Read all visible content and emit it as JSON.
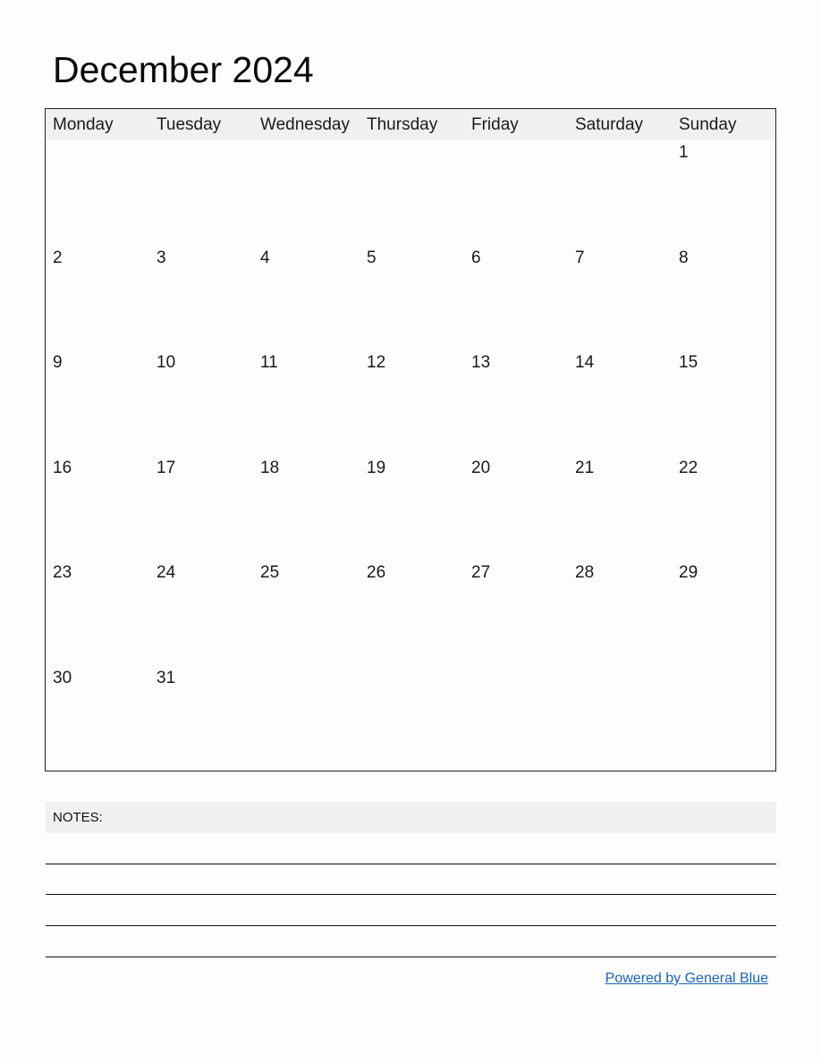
{
  "title": "December 2024",
  "weekdays": [
    "Monday",
    "Tuesday",
    "Wednesday",
    "Thursday",
    "Friday",
    "Saturday",
    "Sunday"
  ],
  "weeks": [
    [
      "",
      "",
      "",
      "",
      "",
      "",
      "1"
    ],
    [
      "2",
      "3",
      "4",
      "5",
      "6",
      "7",
      "8"
    ],
    [
      "9",
      "10",
      "11",
      "12",
      "13",
      "14",
      "15"
    ],
    [
      "16",
      "17",
      "18",
      "19",
      "20",
      "21",
      "22"
    ],
    [
      "23",
      "24",
      "25",
      "26",
      "27",
      "28",
      "29"
    ],
    [
      "30",
      "31",
      "",
      "",
      "",
      "",
      ""
    ]
  ],
  "notes": {
    "label": "NOTES:",
    "line_count": 4
  },
  "footer": {
    "link_text": "Powered by General Blue",
    "link_color": "#1a63b8"
  }
}
